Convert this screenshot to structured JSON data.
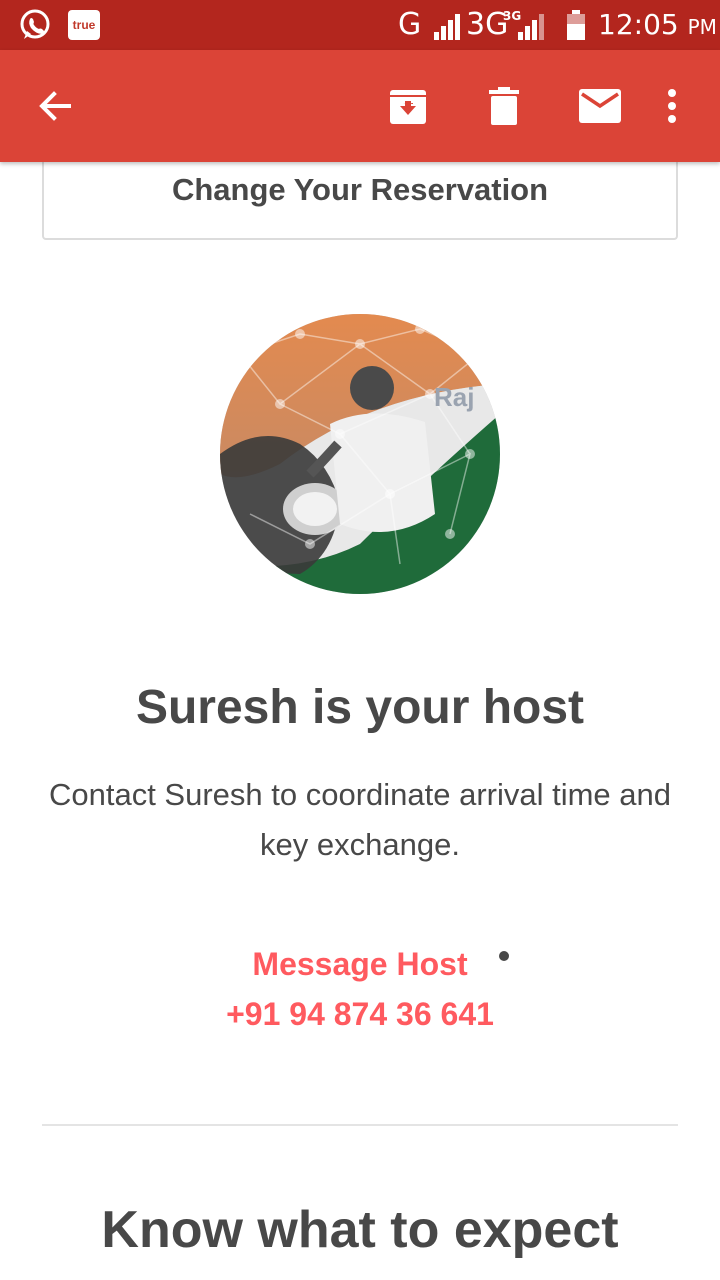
{
  "status_bar": {
    "true_label": "true",
    "g_label": "G",
    "network_label": "3G",
    "network_sup": "3G",
    "clock": "12:05",
    "ampm": "PM",
    "icons": [
      "whatsapp-icon",
      "truecaller-icon",
      "signal-icon",
      "battery-icon"
    ]
  },
  "app_bar": {
    "background": "#db4437",
    "icons": [
      "back-arrow-icon",
      "archive-icon",
      "trash-icon",
      "mail-icon",
      "more-vert-icon"
    ]
  },
  "email": {
    "reservation_button": "Change Your Reservation",
    "host_heading": "Suresh is your host",
    "host_description": "Contact Suresh to coordinate arrival time and key exchange.",
    "message_host_link": "Message Host",
    "phone": "+91 94 874 36 641",
    "expect_heading": "Know what to expect",
    "accent_color": "#ff5a5f",
    "text_color": "#484848",
    "avatar_overlay_text": "Raj"
  }
}
